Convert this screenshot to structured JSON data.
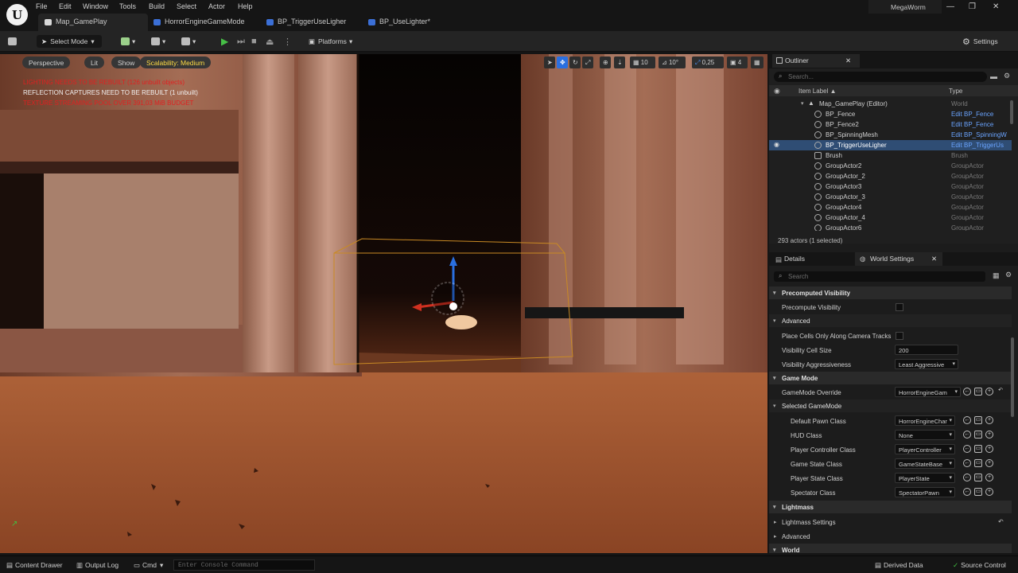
{
  "app": {
    "logo_glyph": "U",
    "user": "MegaWorm"
  },
  "menu": [
    "File",
    "Edit",
    "Window",
    "Tools",
    "Build",
    "Select",
    "Actor",
    "Help"
  ],
  "tabs": [
    {
      "label": "Map_GamePlay",
      "active": true,
      "icon": "map-icon"
    },
    {
      "label": "HorrorEngineGameMode",
      "active": false,
      "icon": "blueprint-icon"
    },
    {
      "label": "BP_TriggerUseLigher",
      "active": false,
      "icon": "blueprint-icon"
    },
    {
      "label": "BP_UseLighter*",
      "active": false,
      "icon": "blueprint-icon"
    }
  ],
  "window_controls": {
    "minimize": "—",
    "restore": "❐",
    "close": "✕"
  },
  "toolbar": {
    "select_mode": "Select Mode",
    "platforms": "Platforms",
    "settings": "Settings"
  },
  "viewport": {
    "perspective": "Perspective",
    "lit": "Lit",
    "show": "Show",
    "scalability": "Scalability: Medium",
    "warnings": [
      {
        "text": "LIGHTING NEEDS TO BE REBUILT (126 unbuilt objects)",
        "color": "#e02020"
      },
      {
        "text": "REFLECTION CAPTURES NEED TO BE REBUILT (1 unbuilt)",
        "color": "#f0f0f0"
      },
      {
        "text": "TEXTURE STREAMING POOL OVER 391,03 MiB BUDGET",
        "color": "#e02020"
      }
    ],
    "grid_snap": "10",
    "rot_snap": "10°",
    "scale_snap": "0,25",
    "cam_speed": "4"
  },
  "outliner": {
    "tab": "Outliner",
    "search_placeholder": "Search...",
    "col_label": "Item Label ▲",
    "col_type": "Type",
    "rows": [
      {
        "label": "Map_GamePlay (Editor)",
        "type": "World",
        "link": false
      },
      {
        "label": "BP_Fence",
        "type": "Edit BP_Fence",
        "link": true
      },
      {
        "label": "BP_Fence2",
        "type": "Edit BP_Fence",
        "link": true
      },
      {
        "label": "BP_SpinningMesh",
        "type": "Edit BP_SpinningW",
        "link": true
      },
      {
        "label": "BP_TriggerUseLigher",
        "type": "Edit BP_TriggerUs",
        "link": true
      },
      {
        "label": "Brush",
        "type": "Brush",
        "link": false
      },
      {
        "label": "GroupActor2",
        "type": "GroupActor",
        "link": false
      },
      {
        "label": "GroupActor_2",
        "type": "GroupActor",
        "link": false
      },
      {
        "label": "GroupActor3",
        "type": "GroupActor",
        "link": false
      },
      {
        "label": "GroupActor_3",
        "type": "GroupActor",
        "link": false
      },
      {
        "label": "GroupActor4",
        "type": "GroupActor",
        "link": false
      },
      {
        "label": "GroupActor_4",
        "type": "GroupActor",
        "link": false
      },
      {
        "label": "GroupActor6",
        "type": "GroupActor",
        "link": false
      }
    ],
    "footer": "293 actors (1 selected)"
  },
  "details": {
    "tab_details": "Details",
    "tab_world": "World Settings",
    "search_placeholder": "Search",
    "sections": {
      "precomputed": "Precomputed Visibility",
      "advanced": "Advanced",
      "game_mode": "Game Mode",
      "selected_game_mode": "Selected GameMode",
      "lightmass": "Lightmass",
      "lightmass_settings": "Lightmass Settings",
      "advanced2": "Advanced",
      "world": "World"
    },
    "rows": {
      "precompute_visibility": "Precompute Visibility",
      "place_cells": "Place Cells Only Along Camera Tracks",
      "visibility_cell_size": "Visibility Cell Size",
      "visibility_cell_size_value": "200",
      "visibility_aggressiveness": "Visibility Aggressiveness",
      "visibility_aggressiveness_value": "Least Aggressive",
      "gamemode_override": "GameMode Override",
      "gamemode_override_value": "HorrorEngineGam",
      "default_pawn": "Default Pawn Class",
      "default_pawn_value": "HorrorEngineChar",
      "hud": "HUD Class",
      "hud_value": "None",
      "player_controller": "Player Controller Class",
      "player_controller_value": "PlayerController",
      "game_state": "Game State Class",
      "game_state_value": "GameStateBase",
      "player_state": "Player State Class",
      "player_state_value": "PlayerState",
      "spectator": "Spectator Class",
      "spectator_value": "SpectatorPawn"
    }
  },
  "statusbar": {
    "content_drawer": "Content Drawer",
    "output_log": "Output Log",
    "cmd": "Cmd",
    "console_placeholder": "Enter Console Command",
    "derived_data": "Derived Data",
    "source_control": "Source Control"
  }
}
